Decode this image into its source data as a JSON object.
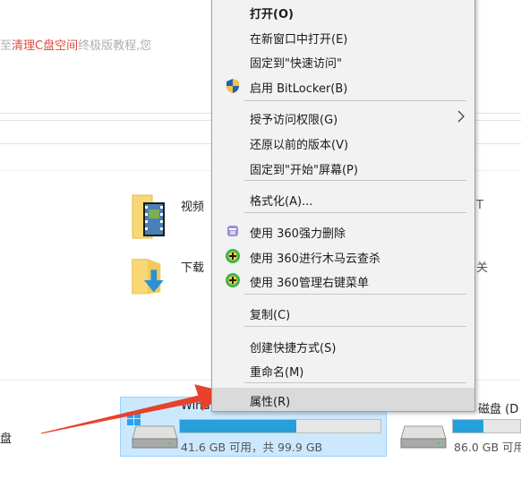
{
  "background": {
    "partial_text_red": "清理C盘空间",
    "partial_text_left": "至",
    "partial_text_right": "终极版教程,您",
    "right_fragments": [
      "T",
      "关"
    ],
    "folders": [
      {
        "label": "视频",
        "icon": "video-folder-icon"
      },
      {
        "label": "下载",
        "icon": "download-folder-icon"
      }
    ],
    "side_label": "盘",
    "drives": [
      {
        "name": "Wind",
        "capacity": "41.6 GB 可用，共 99.9 GB",
        "used_fraction": 0.58,
        "selected": true
      },
      {
        "name": "磁盘 (D",
        "capacity": "86.0 GB 可用",
        "used_fraction": 0.45,
        "selected": false
      }
    ]
  },
  "context_menu": {
    "items": [
      {
        "label": "打开(O)",
        "bold": true
      },
      {
        "label": "在新窗口中打开(E)"
      },
      {
        "label": "固定到\"快速访问\""
      },
      {
        "label": "启用 BitLocker(B)",
        "icon": "shield-icon"
      },
      {
        "label": "授予访问权限(G)",
        "submenu": true
      },
      {
        "label": "还原以前的版本(V)"
      },
      {
        "label": "固定到\"开始\"屏幕(P)"
      },
      {
        "label": "格式化(A)..."
      },
      {
        "label": "使用 360强力删除",
        "icon": "360-delete-icon"
      },
      {
        "label": "使用 360进行木马云查杀",
        "icon": "360-scan-icon"
      },
      {
        "label": "使用 360管理右键菜单",
        "icon": "360-manage-icon"
      },
      {
        "label": "复制(C)"
      },
      {
        "label": "创建快捷方式(S)"
      },
      {
        "label": "重命名(M)"
      },
      {
        "label": "属性(R)",
        "highlighted": true
      }
    ]
  },
  "annotation": {
    "arrow_color": "#e8412c"
  }
}
